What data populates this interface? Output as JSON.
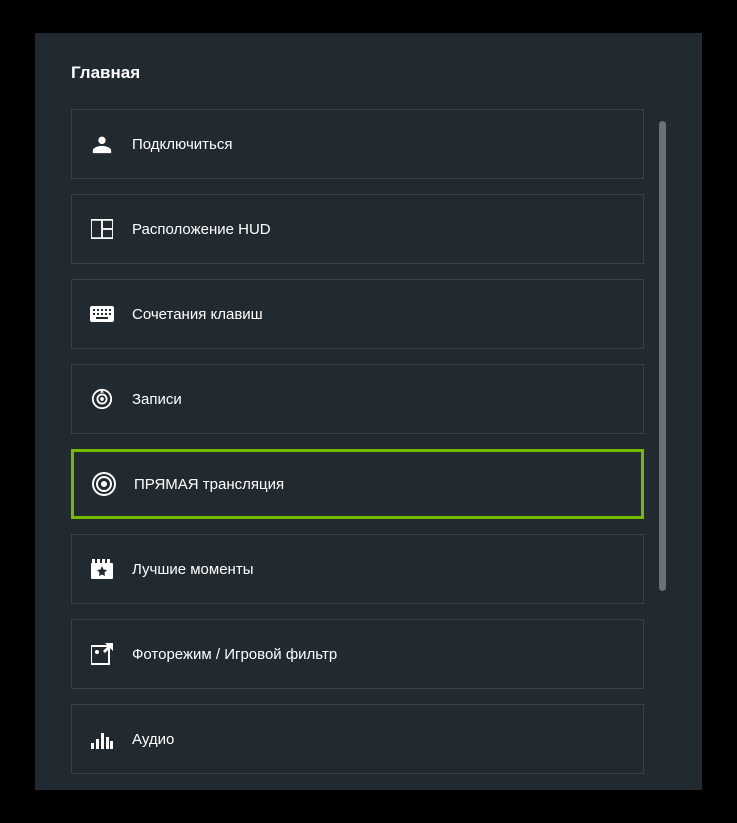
{
  "title": "Главная",
  "items": [
    {
      "label": "Подключиться",
      "icon": "user-icon",
      "highlighted": false
    },
    {
      "label": "Расположение HUD",
      "icon": "layout-icon",
      "highlighted": false
    },
    {
      "label": "Сочетания клавиш",
      "icon": "keyboard-icon",
      "highlighted": false
    },
    {
      "label": "Записи",
      "icon": "record-icon",
      "highlighted": false
    },
    {
      "label": "ПРЯМАЯ трансляция",
      "icon": "broadcast-icon",
      "highlighted": true
    },
    {
      "label": "Лучшие моменты",
      "icon": "highlights-icon",
      "highlighted": false
    },
    {
      "label": "Фоторежим / Игровой фильтр",
      "icon": "photo-icon",
      "highlighted": false
    },
    {
      "label": "Аудио",
      "icon": "audio-icon",
      "highlighted": false
    }
  ]
}
